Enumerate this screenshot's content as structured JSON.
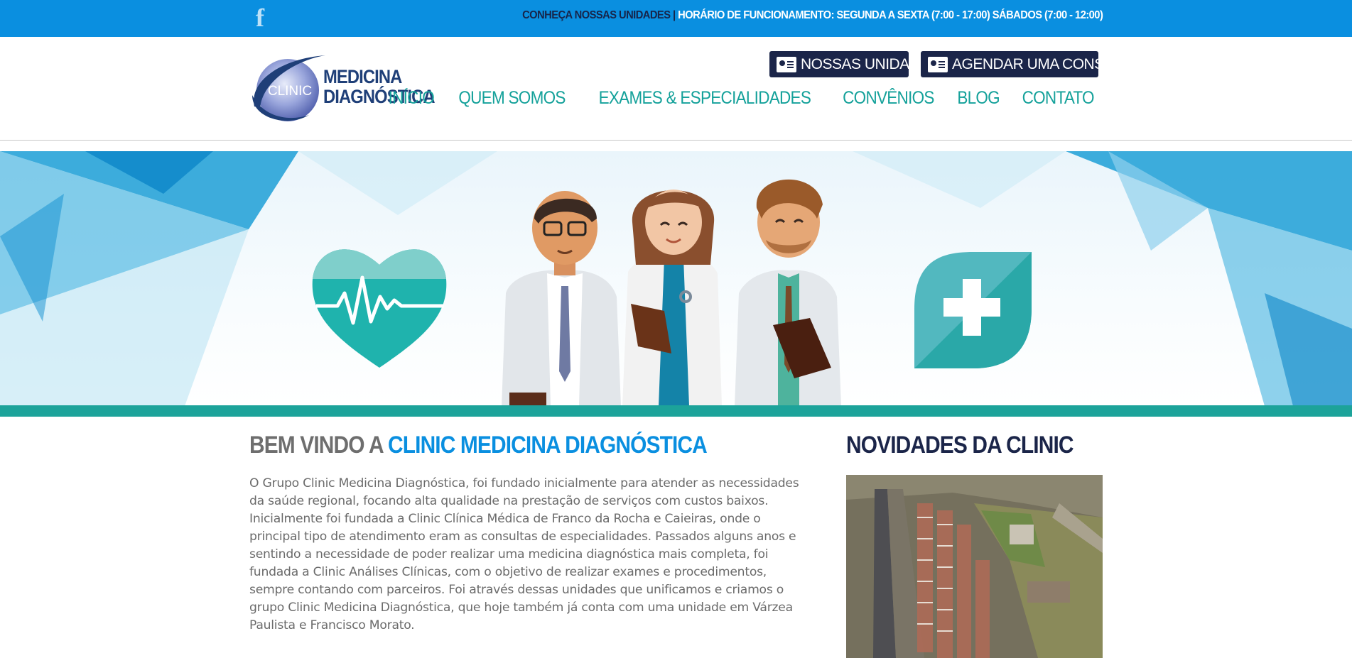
{
  "topbar": {
    "facebook_icon": "facebook-icon",
    "units_link": "CONHEÇA NOSSAS UNIDADES",
    "separator": " | ",
    "hours": "HORÁRIO DE FUNCIONAMENTO: SEGUNDA A SEXTA (7:00 - 17:00) SÁBADOS (7:00 - 12:00)",
    "colors": {
      "background": "#0a8fe0",
      "dark_text": "#17254a"
    }
  },
  "header": {
    "logo": {
      "line1": "MEDICINA",
      "line2": "DIAGNÓSTICA",
      "badge": "CLINIC"
    },
    "buttons": [
      {
        "label": "NOSSAS UNIDADES",
        "icon": "id-card-icon"
      },
      {
        "label": "AGENDAR UMA CONSULTA",
        "icon": "id-card-icon"
      }
    ],
    "nav": [
      "INÍCIO",
      "QUEM SOMOS",
      "EXAMES & ESPECIALIDADES",
      "CONVÊNIOS",
      "BLOG",
      "CONTATO"
    ],
    "colors": {
      "nav": "#14a19a",
      "button_bg": "#1b2549"
    }
  },
  "hero": {
    "icons": [
      "heart-pulse-icon",
      "medical-cross-icon"
    ],
    "illustration": "three-doctors-illustration",
    "colors": {
      "accent_teal": "#1ca39a",
      "hero_blue": "#0a8fe0"
    }
  },
  "main": {
    "welcome_prefix": "BEM VINDO A ",
    "welcome_brand": "CLINIC MEDICINA DIAGNÓSTICA",
    "paragraph": "O Grupo Clinic Medicina Diagnóstica, foi fundado inicialmente para atender as necessidades da saúde regional, focando alta qualidade na prestação de serviços com custos baixos. Inicialmente foi fundada a Clinic Clínica Médica de Franco da Rocha e Caieiras, onde o principal tipo de atendimento eram as consultas de especialidades. Passados alguns anos e sentindo a necessidade de poder realizar uma medicina diagnóstica mais completa, foi fundada a Clinic Análises Clínicas, com o objetivo de realizar exames e procedimentos, sempre contando com parceiros. Foi através dessas unidades que unificamos e criamos o grupo Clinic Medicina Diagnóstica, que hoje também já conta com uma unidade em Várzea Paulista e Francisco Morato."
  },
  "sidebar": {
    "news_title": "NOVIDADES DA CLINIC",
    "news_image": "aerial-city-photo"
  }
}
